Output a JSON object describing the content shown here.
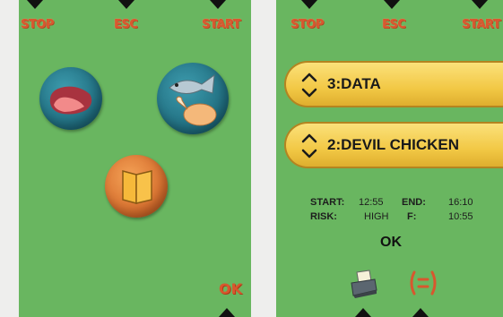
{
  "left_screen": {
    "top_labels": {
      "stop": "STOP",
      "esc": "ESC",
      "start": "START"
    },
    "ok": "OK"
  },
  "right_screen": {
    "top_labels": {
      "stop": "STOP",
      "esc": "ESC",
      "start": "START"
    },
    "program_selector": "3:DATA",
    "recipe_selector": "2:DEVIL CHICKEN",
    "details": {
      "start_label": "START:",
      "start_value": "12:55",
      "end_label": "END:",
      "end_value": "16:10",
      "risk_label": "RISK:",
      "risk_value": "HIGH",
      "f_label": "F:",
      "f_value": "10:55"
    },
    "ok": "OK"
  },
  "colors": {
    "screen_bg": "#69b660",
    "accent_label": "#d8572e",
    "pill_yellow": "#f2c845",
    "round_teal": "#1e6a7c",
    "round_orange": "#d46a2a"
  },
  "icons": [
    "meat-icon",
    "fish-icon",
    "chicken-icon",
    "book-icon",
    "printer-icon",
    "settings-icon",
    "up-down-arrows-icon"
  ]
}
